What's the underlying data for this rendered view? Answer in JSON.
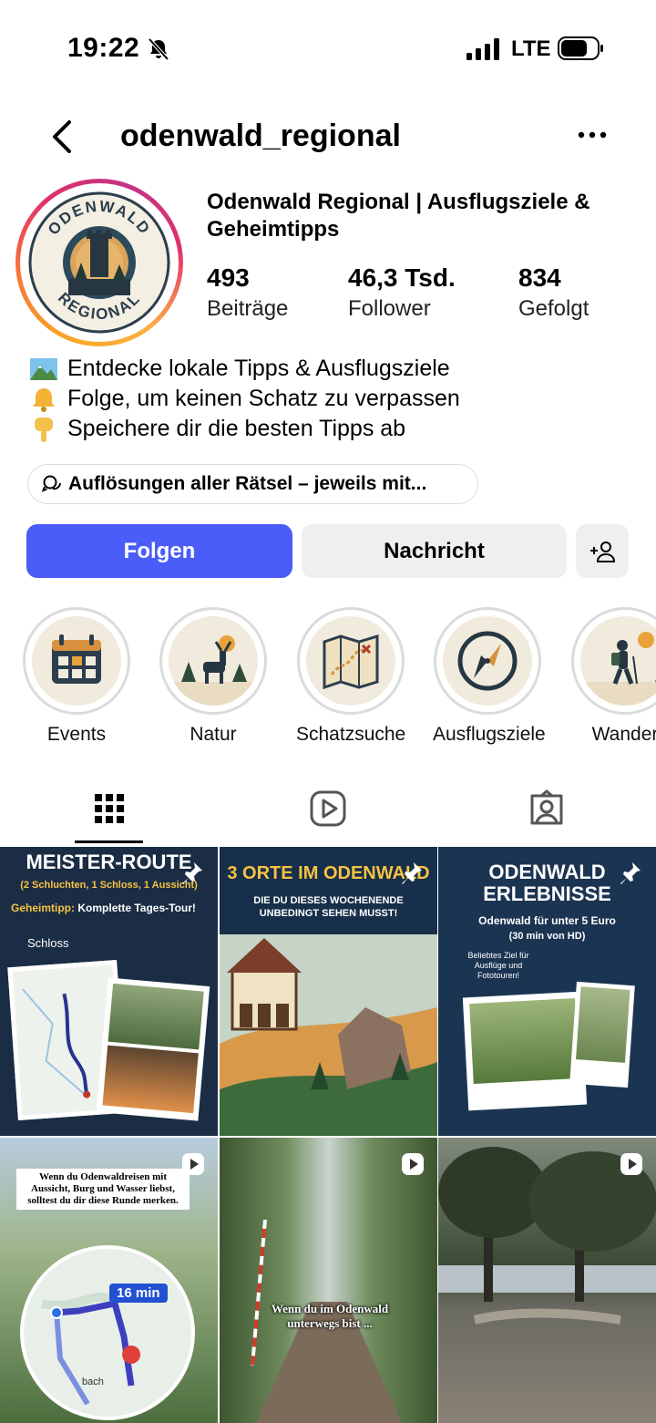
{
  "status": {
    "time": "19:22",
    "network": "LTE",
    "icons": [
      "bell-muted-icon",
      "signal-icon",
      "battery-icon"
    ]
  },
  "header": {
    "username": "odenwald_regional",
    "back_icon": "chevron-left-icon",
    "more_icon": "more-horizontal-icon"
  },
  "profile": {
    "avatar_top_text": "ODENWALD",
    "avatar_bottom_text": "REGIONAL",
    "display_name": "Odenwald Regional | Ausflugsziele & Geheimtipps",
    "stats": [
      {
        "value": "493",
        "label": "Beiträge"
      },
      {
        "value": "46,3 Tsd.",
        "label": "Follower"
      },
      {
        "value": "834",
        "label": "Gefolgt"
      }
    ],
    "bio": [
      {
        "icon": "landscape-emoji",
        "text": "Entdecke lokale Tipps & Ausflugsziele"
      },
      {
        "icon": "bell-emoji",
        "text": "Folge, um keinen Schatz zu verpassen"
      },
      {
        "icon": "pointing-down-emoji",
        "text": "Speichere dir die besten Tipps ab"
      }
    ],
    "thread_chip": "Auflösungen aller Rätsel – jeweils mit..."
  },
  "actions": {
    "follow": "Folgen",
    "message": "Nachricht",
    "follow_color": "#4a5df9"
  },
  "highlights": [
    {
      "label": "Events",
      "icon": "calendar-icon"
    },
    {
      "label": "Natur",
      "icon": "deer-icon"
    },
    {
      "label": "Schatzsuche",
      "icon": "treasure-map-icon"
    },
    {
      "label": "Ausflugsziele",
      "icon": "compass-icon"
    },
    {
      "label": "Wander",
      "icon": "hiker-icon"
    }
  ],
  "tabs": [
    "grid-icon",
    "reels-icon",
    "tagged-icon"
  ],
  "posts": [
    {
      "title": "MEISTER-ROUTE",
      "subtitle": "(2 Schluchten, 1 Schloss, 1 Aussicht)",
      "tip_label": "Geheimtipp:",
      "tip_text": "Komplette Tages-Tour!",
      "note": "Schloss",
      "pinned": true
    },
    {
      "title": "3 ORTE IM ODENWALD",
      "subtitle": "DIE DU DIESES WOCHENENDE UNBEDINGT SEHEN MUSST!",
      "pinned": true
    },
    {
      "title": "ODENWALD ERLEBNISSE",
      "subtitle": "Odenwald für unter 5 Euro",
      "note": "(30 min von HD)",
      "side": "Beliebtes Ziel für Ausflüge und Fototouren!",
      "pinned": true
    },
    {
      "caption": "Wenn du Odenwaldreisen mit Aussicht, Burg und Wasser liebst, solltest du dir diese Runde merken.",
      "route_time": "16 min",
      "place": "bach",
      "reel": true
    },
    {
      "caption": "Wenn du im Odenwald unterwegs bist ...",
      "reel": true
    },
    {
      "reel": true
    }
  ]
}
